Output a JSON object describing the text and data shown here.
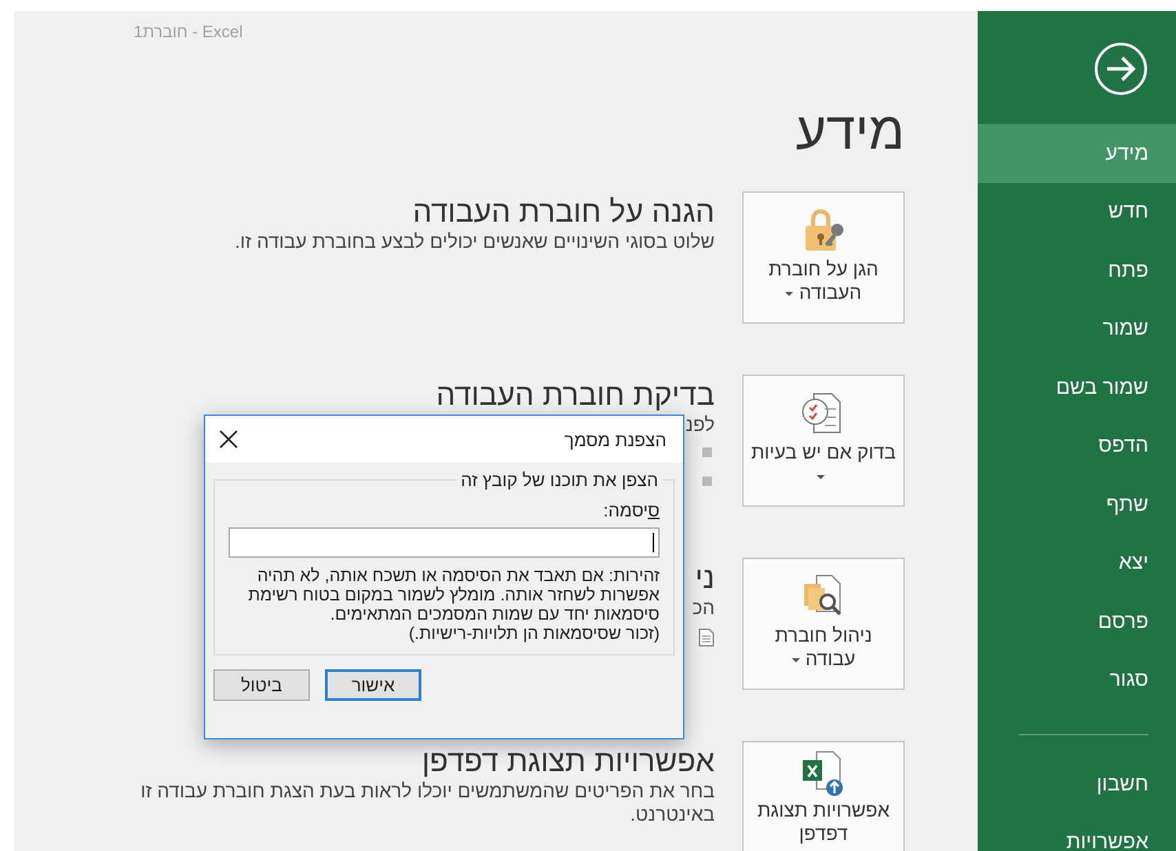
{
  "window": {
    "title": "חוברת1 - Excel"
  },
  "page": {
    "heading": "מידע"
  },
  "sections": [
    {
      "kind": "protect",
      "button": {
        "label": "הגן על חוברת העבודה",
        "dropdown": true
      },
      "title": "הגנה על חוברת העבודה",
      "description": "שלוט בסוגי השינויים שאנשים יכולים לבצע בחוברת עבודה זו."
    },
    {
      "kind": "inspect",
      "button": {
        "label": "בדוק אם יש בעיות",
        "dropdown": true
      },
      "title": "בדיקת חוברת העבודה",
      "description": "לפנ"
    },
    {
      "kind": "manage",
      "button": {
        "label": "ניהול חוברת עבודה",
        "dropdown": true
      },
      "title": "ני",
      "description": "הכ"
    },
    {
      "kind": "browser",
      "button": {
        "label": "אפשרויות תצוגת דפדפן",
        "dropdown": false
      },
      "title": "אפשרויות תצוגת דפדפן",
      "description": "בחר את הפריטים שהמשתמשים יוכלו לראות בעת הצגת חוברת עבודה זו באינטרנט."
    }
  ],
  "dialog": {
    "title": "הצפנת מסמך",
    "group": "הצפן את תוכנו של קובץ זה",
    "password_label": "סיסמה:",
    "warning": "זהירות: אם תאבד את הסיסמה או תשכח אותה, לא תהיה אפשרות לשחזר אותה. מומלץ לשמור במקום בטוח רשימת סיסמאות יחד עם שמות המסמכים המתאימים.",
    "note": "(זכור שסיסמאות הן תלויות-רישיות.)",
    "buttons": [
      {
        "label": "אישור",
        "default": true
      },
      {
        "label": "ביטול",
        "default": false
      }
    ]
  },
  "sidebar": {
    "items": [
      {
        "label": "מידע",
        "selected": true
      },
      {
        "label": "חדש",
        "selected": false
      },
      {
        "label": "פתח",
        "selected": false
      },
      {
        "label": "שמור",
        "selected": false
      },
      {
        "label": "שמור בשם",
        "selected": false
      },
      {
        "label": "הדפס",
        "selected": false
      },
      {
        "label": "שתף",
        "selected": false
      },
      {
        "label": "יצא",
        "selected": false
      },
      {
        "label": "פרסם",
        "selected": false
      },
      {
        "label": "סגור",
        "selected": false
      }
    ],
    "bottom_items": [
      {
        "label": "חשבון",
        "selected": false
      },
      {
        "label": "אפשרויות",
        "selected": false
      }
    ]
  }
}
